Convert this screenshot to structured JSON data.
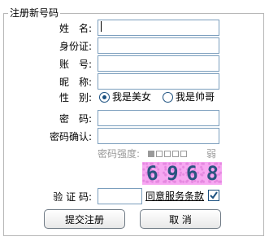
{
  "form": {
    "legend": "注册新号码",
    "fields": {
      "name": {
        "label": "姓　名:",
        "value": ""
      },
      "id_card": {
        "label": "身份证:",
        "value": ""
      },
      "account": {
        "label": "账　号:",
        "value": ""
      },
      "nickname": {
        "label": "昵　称:",
        "value": ""
      },
      "password": {
        "label": "密　码:",
        "value": ""
      },
      "password_confirm": {
        "label": "密码确认:",
        "value": ""
      },
      "captcha": {
        "label": "验 证 码:",
        "value": ""
      }
    },
    "gender": {
      "label": "性　别:",
      "options": [
        {
          "label": "我是美女",
          "checked": true
        },
        {
          "label": "我是帅哥",
          "checked": false
        }
      ]
    },
    "password_strength": {
      "label": "密码强度:",
      "level_text": "弱",
      "filled_segments": 1,
      "total_segments": 5
    },
    "captcha_image_text": [
      "6",
      "9",
      "6",
      "8"
    ],
    "agree_terms": {
      "label": "同意服务条款",
      "checked": true
    },
    "buttons": {
      "submit": "提交注册",
      "cancel": "取 消"
    }
  },
  "colors": {
    "captcha_bg": "#f7a8f2",
    "captcha_text": "#2a5480",
    "accent": "#1c5180"
  }
}
